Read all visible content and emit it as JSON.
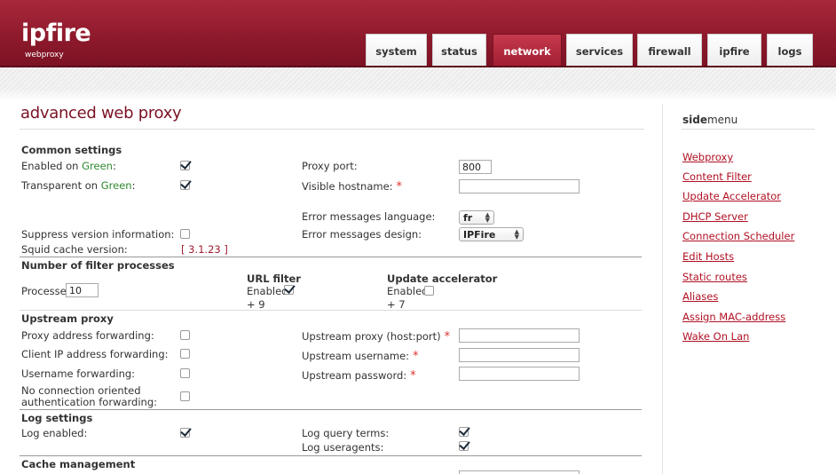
{
  "app": {
    "logo": "ipfire",
    "logo_sub": "webproxy"
  },
  "nav": {
    "tabs": [
      {
        "label": "system"
      },
      {
        "label": "status"
      },
      {
        "label": "network"
      },
      {
        "label": "services"
      },
      {
        "label": "firewall"
      },
      {
        "label": "ipfire"
      },
      {
        "label": "logs"
      }
    ],
    "active_tab": "network"
  },
  "page": {
    "title": "advanced web proxy"
  },
  "common": {
    "heading": "Common settings",
    "enabled_on": "Enabled on",
    "green1": "Green",
    "colon": ":",
    "transparent_on": "Transparent on",
    "green2": "Green",
    "suppress": "Suppress version information:",
    "squid": "Squid cache version:",
    "squid_version": "[ 3.1.23 ]",
    "proxy_port_label": "Proxy port:",
    "proxy_port_value": "800",
    "visible_hostname": "Visible hostname:",
    "err_lang_label": "Error messages language:",
    "err_lang_value": "fr",
    "err_design_label": "Error messages design:",
    "err_design_value": "IPFire",
    "enabled_green_checked": true,
    "transparent_checked": true,
    "suppress_checked": false
  },
  "filter": {
    "heading": "Number of filter processes",
    "processes_label": "Processes",
    "processes_value": "10",
    "url_heading": "URL filter",
    "url_enabled": "Enabled",
    "url_plus": "+ 9",
    "update_heading": "Update accelerator",
    "update_enabled": "Enabled",
    "update_plus": "+ 7",
    "url_checked": true,
    "update_checked": false
  },
  "upstream": {
    "heading": "Upstream proxy",
    "addr_fwd": "Proxy address forwarding:",
    "client_ip_fwd": "Client IP address forwarding:",
    "user_fwd": "Username forwarding:",
    "no_conn_1": "No connection oriented",
    "no_conn_2": "authentication forwarding:",
    "host_port": "Upstream proxy (host:port)",
    "username": "Upstream username:",
    "password": "Upstream password:",
    "required_mark": "*"
  },
  "log": {
    "heading": "Log settings",
    "enabled": "Log enabled:",
    "query_terms": "Log query terms:",
    "useragents": "Log useragents:",
    "enabled_checked": true,
    "query_checked": true,
    "useragents_checked": true
  },
  "cache": {
    "heading": "Cache management"
  },
  "sidemenu": {
    "title_bold": "side",
    "title_rest": "menu",
    "items": [
      {
        "label": "Webproxy"
      },
      {
        "label": "Content Filter"
      },
      {
        "label": "Update Accelerator"
      },
      {
        "label": "DHCP Server"
      },
      {
        "label": "Connection Scheduler"
      },
      {
        "label": "Edit Hosts"
      },
      {
        "label": "Static routes"
      },
      {
        "label": "Aliases"
      },
      {
        "label": "Assign MAC-address"
      },
      {
        "label": "Wake On Lan"
      }
    ]
  },
  "colors": {
    "brand": "#8e1a2c",
    "accent": "#b01023",
    "green_text": "#2e8b2e",
    "required": "#e03030"
  }
}
